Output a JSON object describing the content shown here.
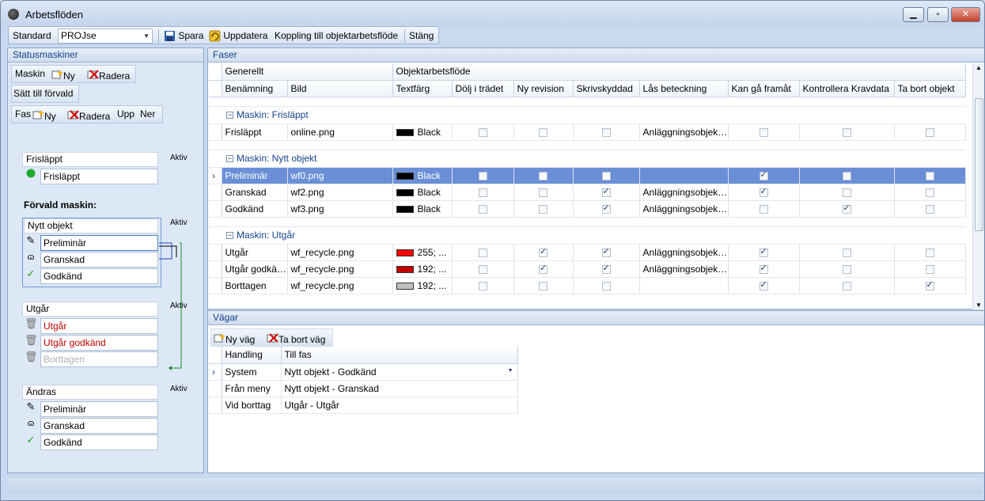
{
  "window": {
    "title": "Arbetsflöden",
    "minimize": "▁",
    "maximize": "▫",
    "close": "✕"
  },
  "toolbar": {
    "standard_label": "Standard",
    "standard_value": "PROJse",
    "save_label": "Spara",
    "update_label": "Uppdatera",
    "link_label": "Koppling till objektarbetsflöde",
    "close_label": "Stäng"
  },
  "left": {
    "header": "Statusmaskiner",
    "machine_bar": {
      "label": "Maskin",
      "new": "Ny",
      "delete": "Radera"
    },
    "set_default": "Sätt till förvald",
    "phase_bar": {
      "label": "Fas",
      "new": "Ny",
      "delete": "Radera",
      "up": "Upp",
      "down": "Ner"
    },
    "default_machine_label": "Förvald maskin:",
    "groups": [
      {
        "name": "Frisläppt",
        "active": "Aktiv",
        "states": [
          {
            "label": "Frisläppt",
            "icon": "green-dot-icon"
          }
        ]
      },
      {
        "name": "Nytt objekt",
        "active": "Aktiv",
        "states": [
          {
            "label": "Preliminär",
            "icon": "pencil-icon"
          },
          {
            "label": "Granskad",
            "icon": "glasses-icon"
          },
          {
            "label": "Godkänd",
            "icon": "check-icon"
          }
        ]
      },
      {
        "name": "Utgår",
        "active": "Aktiv",
        "states": [
          {
            "label": "Utgår",
            "icon": "trash-icon"
          },
          {
            "label": "Utgår godkänd",
            "icon": "trash-icon"
          },
          {
            "label": "Borttagen",
            "icon": "trash-icon"
          }
        ]
      },
      {
        "name": "Ändras",
        "active": "Aktiv",
        "states": [
          {
            "label": "Preliminär",
            "icon": "pencil-icon"
          },
          {
            "label": "Granskad",
            "icon": "glasses-icon"
          },
          {
            "label": "Godkänd",
            "icon": "check-icon"
          }
        ]
      }
    ]
  },
  "faser": {
    "header": "Faser",
    "band_general": "Generellt",
    "band_object": "Objektarbetsflöde",
    "columns": [
      "Benämning",
      "Bild",
      "Textfärg",
      "Dölj i trädet",
      "Ny revision",
      "Skrivskyddad",
      "Lås beteckning",
      "Kan gå framåt",
      "Kontrollera Kravdata",
      "Ta bort objekt"
    ],
    "groups": [
      {
        "title": "Maskin: Frisläppt",
        "rows": [
          {
            "name": "Frisläppt",
            "image": "online.png",
            "color_text": "Black",
            "swatch": "#000000",
            "hide": false,
            "new_rev": false,
            "readonly": false,
            "lock": "Anläggningsobjekt...",
            "forward": false,
            "check": false,
            "remove": false
          }
        ]
      },
      {
        "title": "Maskin: Nytt objekt",
        "rows": [
          {
            "name": "Preliminär",
            "image": "wf0.png",
            "color_text": "Black",
            "swatch": "#000000",
            "hide": false,
            "new_rev": false,
            "readonly": false,
            "lock": "",
            "forward": true,
            "check": false,
            "remove": false,
            "selected": true
          },
          {
            "name": "Granskad",
            "image": "wf2.png",
            "color_text": "Black",
            "swatch": "#000000",
            "hide": false,
            "new_rev": false,
            "readonly": true,
            "lock": "Anläggningsobjekt...",
            "forward": true,
            "check": false,
            "remove": false
          },
          {
            "name": "Godkänd",
            "image": "wf3.png",
            "color_text": "Black",
            "swatch": "#000000",
            "hide": false,
            "new_rev": false,
            "readonly": true,
            "lock": "Anläggningsobjekt...",
            "forward": false,
            "check": true,
            "remove": false
          }
        ]
      },
      {
        "title": "Maskin: Utgår",
        "rows": [
          {
            "name": "Utgår",
            "image": "wf_recycle.png",
            "color_text": "255; ...",
            "swatch": "#ff0000",
            "hide": false,
            "new_rev": true,
            "readonly": true,
            "lock": "Anläggningsobjekt...",
            "forward": true,
            "check": false,
            "remove": false
          },
          {
            "name": "Utgår godkänd",
            "image": "wf_recycle.png",
            "color_text": "192; ...",
            "swatch": "#c00000",
            "hide": false,
            "new_rev": true,
            "readonly": true,
            "lock": "Anläggningsobjekt...",
            "forward": true,
            "check": false,
            "remove": false
          },
          {
            "name": "Borttagen",
            "image": "wf_recycle.png",
            "color_text": "192; ...",
            "swatch": "#c0c0c0",
            "hide": false,
            "new_rev": false,
            "readonly": false,
            "lock": "",
            "forward": true,
            "check": false,
            "remove": true
          }
        ]
      }
    ]
  },
  "vagar": {
    "header": "Vägar",
    "new": "Ny väg",
    "delete": "Ta bort väg",
    "columns": [
      "Handling",
      "Till fas"
    ],
    "rows": [
      {
        "action": "System",
        "to": "Nytt objekt - Godkänd",
        "current": true
      },
      {
        "action": "Från meny",
        "to": "Nytt objekt - Granskad"
      },
      {
        "action": "Vid borttag",
        "to": "Utgår - Utgår"
      }
    ]
  }
}
